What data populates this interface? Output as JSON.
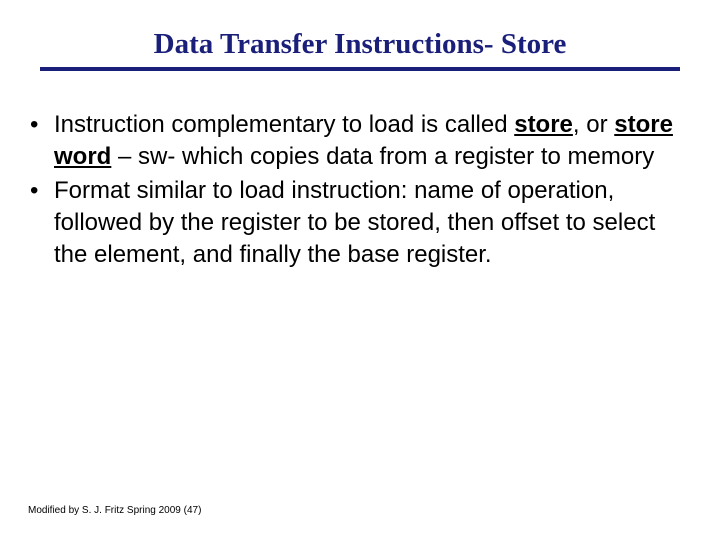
{
  "title": "Data Transfer Instructions- Store",
  "bullets": [
    {
      "parts": [
        {
          "t": "Instruction complementary to load is called "
        },
        {
          "t": "store",
          "b": true,
          "u": true
        },
        {
          "t": ",  or "
        },
        {
          "t": "store word",
          "b": true,
          "u": true
        },
        {
          "t": " – sw- which copies data from a register to  memory"
        }
      ]
    },
    {
      "parts": [
        {
          "t": "Format similar to load instruction: name of operation, followed by the register to be stored, then offset to select the element, and finally the base register."
        }
      ]
    }
  ],
  "footer": "Modified by S. J. Fritz  Spring 2009 (47)"
}
